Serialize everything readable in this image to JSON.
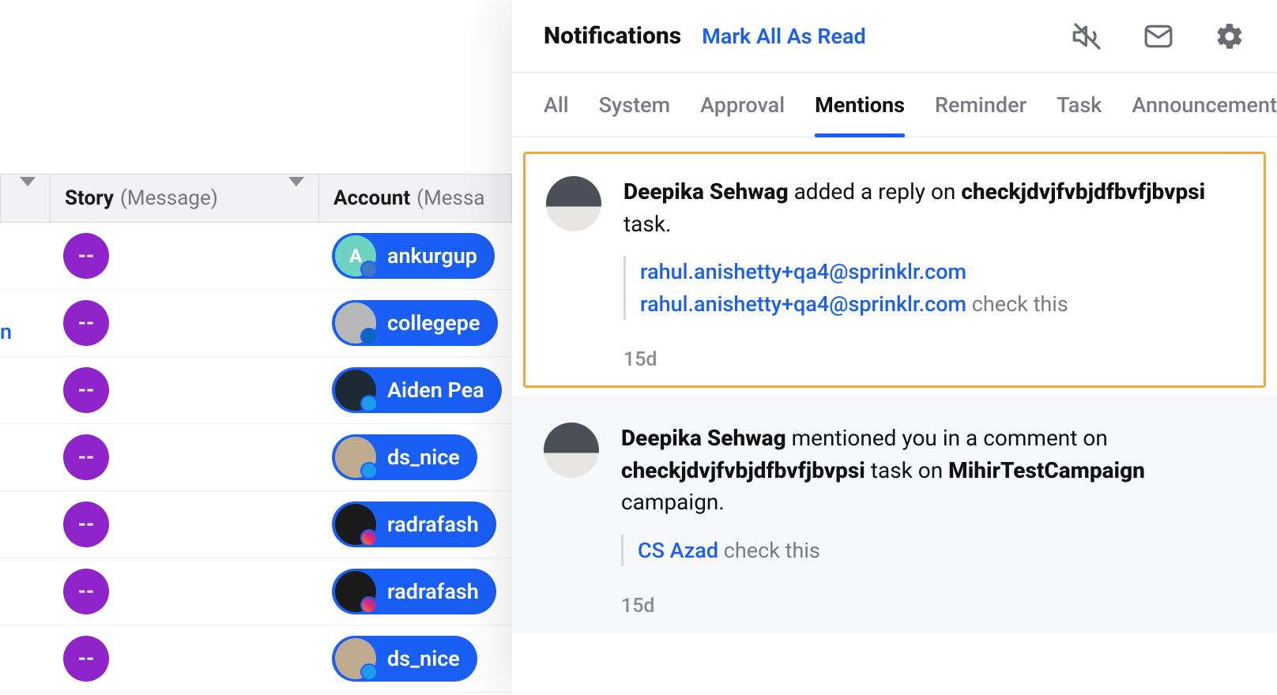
{
  "panel": {
    "title": "Notifications",
    "mark_read": "Mark All As Read"
  },
  "tabs": [
    {
      "label": "All",
      "active": false
    },
    {
      "label": "System",
      "active": false
    },
    {
      "label": "Approval",
      "active": false
    },
    {
      "label": "Mentions",
      "active": true
    },
    {
      "label": "Reminder",
      "active": false
    },
    {
      "label": "Task",
      "active": false
    },
    {
      "label": "Announcement",
      "active": false
    }
  ],
  "notifications": [
    {
      "actor": "Deepika Sehwag",
      "action_pre": " added a reply on ",
      "object": "checkjdvjfvbjdfbvfjbvpsi",
      "action_post": " task.",
      "quote_mentions": [
        "rahul.anishetty+qa4@sprinklr.com",
        "rahul.anishetty+qa4@sprinklr.com"
      ],
      "quote_suffix": " check this",
      "time": "15d",
      "highlighted": true
    },
    {
      "actor": "Deepika Sehwag",
      "action_pre": " mentioned you in a comment on ",
      "object": "checkjdvjfvbjdfbvfjbvpsi",
      "action_mid": " task on ",
      "object2": "MihirTestCampaign",
      "action_post": " campaign.",
      "quote_mentions": [
        "CS Azad"
      ],
      "quote_suffix": " check this",
      "time": "15d",
      "highlighted": false
    }
  ],
  "columns": {
    "story_label": "Story",
    "story_sub": "(Message)",
    "account_label": "Account",
    "account_sub": "(Messa"
  },
  "rows": [
    {
      "story": "--",
      "account": "ankurgup",
      "avatar": "green",
      "letter": "A",
      "platform": "wp"
    },
    {
      "story": "--",
      "account": "collegepe",
      "avatar": "gray",
      "letter": "",
      "platform": "li"
    },
    {
      "story": "--",
      "account": "Aiden Pea",
      "avatar": "dark",
      "letter": "",
      "platform": "tw"
    },
    {
      "story": "--",
      "account": "ds_nice",
      "avatar": "dog",
      "letter": "",
      "platform": "tw"
    },
    {
      "story": "--",
      "account": "radrafash",
      "avatar": "black",
      "letter": "",
      "platform": "ig"
    },
    {
      "story": "--",
      "account": "radrafash",
      "avatar": "black",
      "letter": "",
      "platform": "ig"
    },
    {
      "story": "--",
      "account": "ds_nice",
      "avatar": "dog",
      "letter": "",
      "platform": "tw"
    }
  ],
  "left_link": "n"
}
